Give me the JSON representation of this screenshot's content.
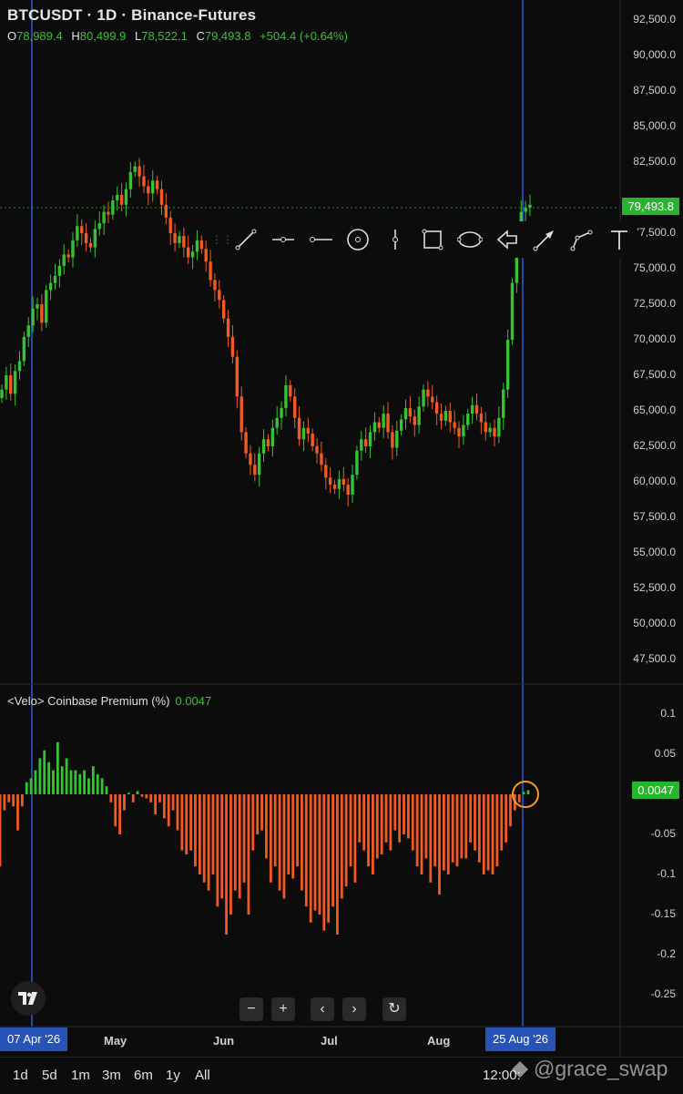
{
  "header": {
    "title": "BTCUSDT · 1D · Binance-Futures",
    "ohlc": [
      {
        "label": "O",
        "value": "78,989.4"
      },
      {
        "label": "H",
        "value": "80,499.9"
      },
      {
        "label": "L",
        "value": "78,522.1"
      },
      {
        "label": "C",
        "value": "79,493.8"
      }
    ],
    "change": "+504.4 (+0.64%)"
  },
  "price_axis": [
    "92,500.0",
    "90,000.0",
    "87,500.0",
    "85,000.0",
    "82,500.0",
    "80,000.0",
    "77,500.0",
    "75,000.0",
    "72,500.0",
    "70,000.0",
    "67,500.0",
    "65,000.0",
    "62,500.0",
    "60,000.0",
    "57,500.0",
    "55,000.0",
    "52,500.0",
    "50,000.0",
    "47,500.0"
  ],
  "last_price": "79,493.8",
  "indicator": {
    "title": "<Velo> Coinbase Premium (%)",
    "value": "0.0047",
    "axis": [
      "0.1",
      "0.05",
      "-0.05",
      "-0.1",
      "-0.15",
      "-0.2",
      "-0.25"
    ],
    "last_value": "0.0047"
  },
  "time_axis": {
    "left_marker": "07 Apr '26",
    "months": [
      "May",
      "Jun",
      "Jul",
      "Aug"
    ],
    "right_marker": "25 Aug '26"
  },
  "drawing_tools": [
    "trend-line",
    "horizontal-ray",
    "ray",
    "circle",
    "vertical-line",
    "rectangle",
    "ellipse",
    "arrow-marker",
    "arrow",
    "path",
    "text"
  ],
  "nav_buttons": {
    "zoom_out": "−",
    "zoom_in": "+",
    "back": "‹",
    "forward": "›",
    "reset": "↻"
  },
  "ranges": [
    "1d",
    "5d",
    "1m",
    "3m",
    "6m",
    "1y",
    "All"
  ],
  "clock": "12:00:",
  "watermark": "@grace_swap",
  "colors": {
    "up": "#36c232",
    "down": "#f05a24",
    "crosshair": "#2f5fd6",
    "marker": "#f39b2e",
    "background": "#0c0c0c"
  },
  "chart_data": {
    "type": "candlestick",
    "title": "BTCUSDT · 1D · Binance-Futures",
    "x_start": "2026-03-31",
    "x_end": "2026-08-27",
    "ylim": [
      46000,
      93500
    ],
    "last": {
      "date": "2026-08-27",
      "open": 78989.4,
      "high": 80499.9,
      "low": 78522.1,
      "close": 79493.8
    },
    "closes": [
      66500,
      67500,
      66200,
      67800,
      68500,
      70200,
      71000,
      72200,
      72500,
      71200,
      73500,
      74000,
      74500,
      75200,
      76000,
      75800,
      77000,
      78000,
      77500,
      76800,
      76500,
      77800,
      78200,
      79000,
      78800,
      79800,
      80200,
      79500,
      80600,
      81800,
      82200,
      81500,
      80800,
      80300,
      81200,
      80600,
      79500,
      78600,
      77500,
      76800,
      77300,
      76500,
      75800,
      76200,
      77000,
      76400,
      75500,
      74200,
      73500,
      72800,
      71500,
      70200,
      68800,
      66000,
      63500,
      62000,
      61200,
      60500,
      62000,
      63000,
      62500,
      63800,
      64500,
      65200,
      66800,
      66000,
      64500,
      63000,
      63800,
      63400,
      62500,
      62000,
      61200,
      60300,
      59800,
      59500,
      60200,
      59800,
      59100,
      60500,
      62200,
      63000,
      62500,
      63500,
      64200,
      63800,
      64800,
      63500,
      62400,
      63600,
      64400,
      65200,
      64600,
      64000,
      65300,
      66500,
      66000,
      65600,
      64800,
      64300,
      65000,
      64200,
      63800,
      63200,
      64000,
      64800,
      65400,
      64800,
      64200,
      63500,
      63800,
      63200,
      64500,
      66500,
      70000,
      74000,
      77500,
      79000,
      79300,
      79500
    ]
  },
  "premium_data": {
    "type": "histogram",
    "values": [
      -0.09,
      -0.02,
      -0.01,
      -0.015,
      -0.045,
      -0.015,
      0.015,
      0.02,
      0.03,
      0.045,
      0.055,
      0.04,
      0.03,
      0.065,
      0.035,
      0.045,
      0.03,
      0.03,
      0.025,
      0.03,
      0.02,
      0.035,
      0.025,
      0.02,
      0.01,
      -0.01,
      -0.04,
      -0.05,
      -0.02,
      0.002,
      -0.01,
      0.004,
      -0.003,
      -0.005,
      -0.01,
      -0.025,
      -0.01,
      -0.03,
      -0.04,
      -0.02,
      -0.045,
      -0.07,
      -0.075,
      -0.07,
      -0.09,
      -0.1,
      -0.11,
      -0.12,
      -0.1,
      -0.14,
      -0.13,
      -0.175,
      -0.15,
      -0.12,
      -0.13,
      -0.11,
      -0.15,
      -0.07,
      -0.05,
      -0.045,
      -0.08,
      -0.11,
      -0.09,
      -0.12,
      -0.13,
      -0.1,
      -0.105,
      -0.09,
      -0.12,
      -0.14,
      -0.16,
      -0.145,
      -0.15,
      -0.17,
      -0.16,
      -0.14,
      -0.175,
      -0.13,
      -0.115,
      -0.09,
      -0.11,
      -0.06,
      -0.07,
      -0.09,
      -0.1,
      -0.08,
      -0.075,
      -0.06,
      -0.07,
      -0.045,
      -0.06,
      -0.05,
      -0.055,
      -0.07,
      -0.09,
      -0.1,
      -0.08,
      -0.11,
      -0.09,
      -0.125,
      -0.095,
      -0.1,
      -0.085,
      -0.09,
      -0.08,
      -0.08,
      -0.06,
      -0.07,
      -0.085,
      -0.1,
      -0.095,
      -0.1,
      -0.09,
      -0.07,
      -0.06,
      -0.04,
      -0.02,
      -0.01,
      0.003,
      0.005
    ]
  }
}
